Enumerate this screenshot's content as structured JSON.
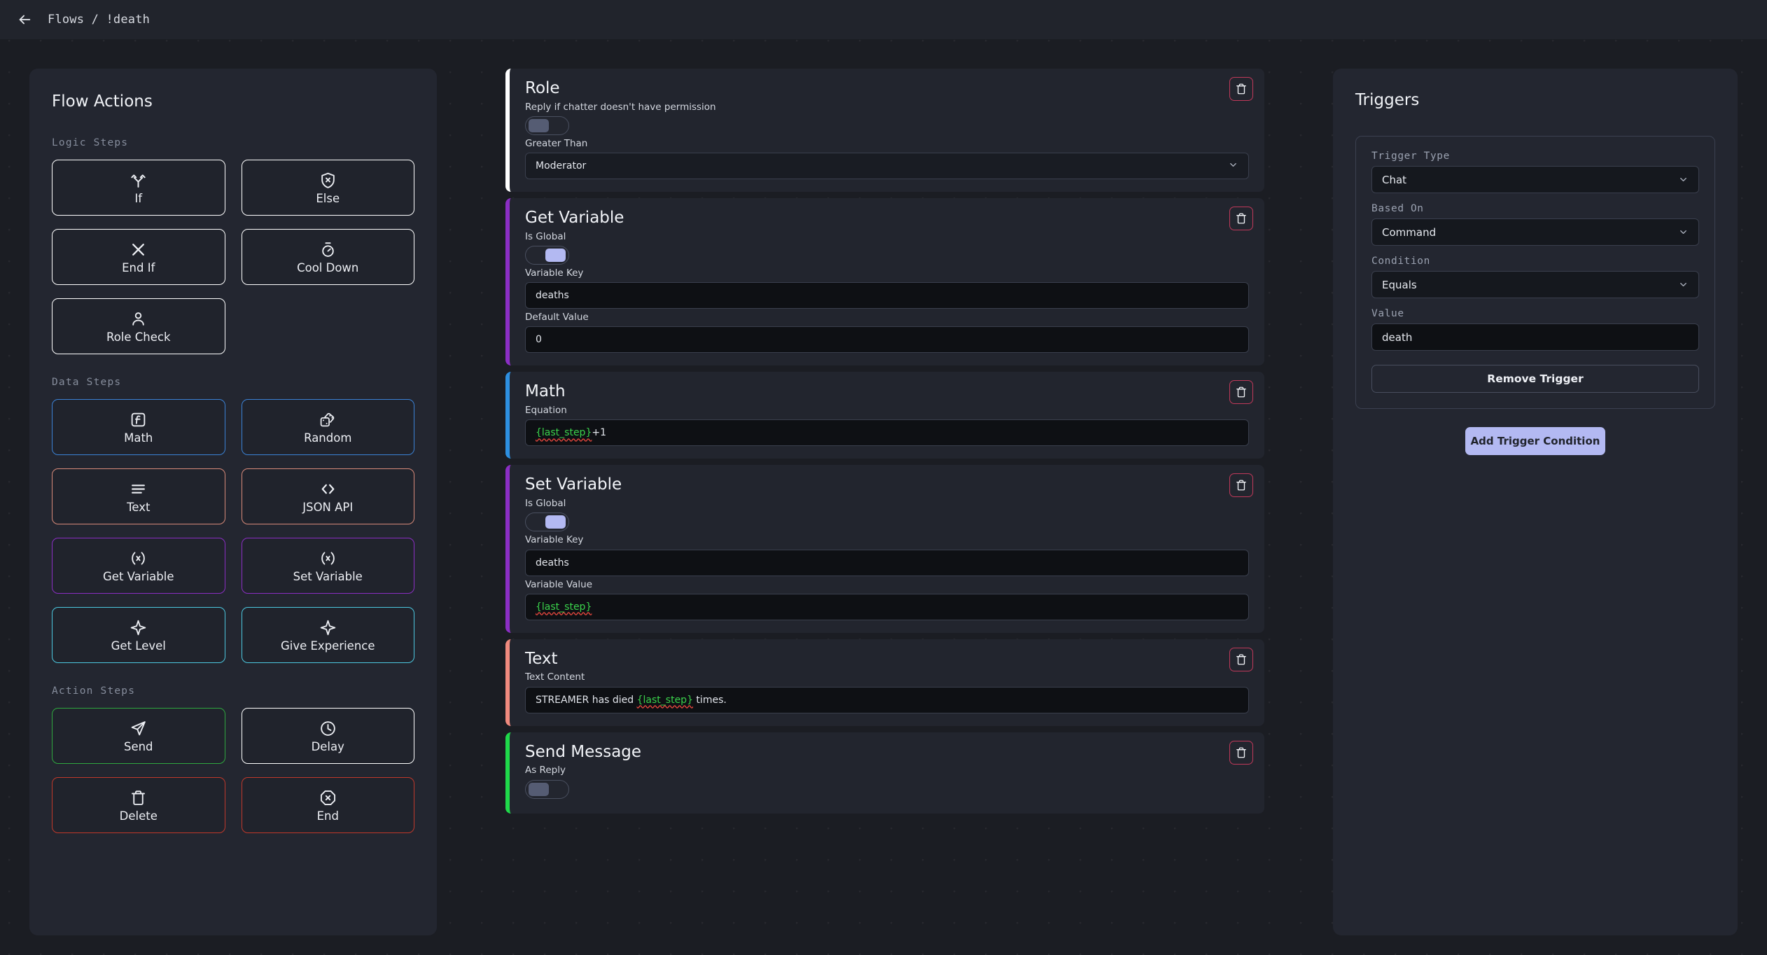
{
  "topbar": {
    "back_icon": "arrow-left-icon",
    "breadcrumb": "Flows / !death"
  },
  "sidebar": {
    "title": "Flow Actions",
    "groups": [
      {
        "label": "Logic Steps",
        "items": [
          {
            "label": "If",
            "icon": "branch-arrows-icon",
            "color": "#ffffff"
          },
          {
            "label": "Else",
            "icon": "shield-x-icon",
            "color": "#ffffff"
          },
          {
            "label": "End If",
            "icon": "x-icon",
            "color": "#ffffff"
          },
          {
            "label": "Cool Down",
            "icon": "stopwatch-icon",
            "color": "#ffffff"
          },
          {
            "label": "Role Check",
            "icon": "user-icon",
            "color": "#ffffff"
          }
        ]
      },
      {
        "label": "Data Steps",
        "items": [
          {
            "label": "Get Level",
            "icon": "sparkle-icon",
            "color": "#4cc8e0"
          },
          {
            "label": "Give Experience",
            "icon": "sparkle-icon",
            "color": "#4cc8e0"
          }
        ],
        "items_full": [
          {
            "label": "Math",
            "icon": "function-box-icon",
            "color": "#3b82d6"
          },
          {
            "label": "Random",
            "icon": "dice-icon",
            "color": "#3b82d6"
          },
          {
            "label": "Text",
            "icon": "lines-icon",
            "color": "#d98b7a"
          },
          {
            "label": "JSON API",
            "icon": "code-brackets-icon",
            "color": "#d98b7a"
          },
          {
            "label": "Get Variable",
            "icon": "variable-x-icon",
            "color": "#8b2ec4"
          },
          {
            "label": "Set Variable",
            "icon": "variable-x-icon",
            "color": "#8b2ec4"
          },
          {
            "label": "Get Level",
            "icon": "sparkle-icon",
            "color": "#4cc8e0"
          },
          {
            "label": "Give Experience",
            "icon": "sparkle-icon",
            "color": "#4cc8e0"
          }
        ]
      },
      {
        "label": "Action Steps",
        "items_full": [
          {
            "label": "Send",
            "icon": "paper-plane-icon",
            "color": "#2fa83f"
          },
          {
            "label": "Delay",
            "icon": "clock-icon",
            "color": "#ffffff"
          },
          {
            "label": "Delete",
            "icon": "trash-icon",
            "color": "#c0392b"
          },
          {
            "label": "End",
            "icon": "octagon-x-icon",
            "color": "#c0392b"
          }
        ]
      }
    ],
    "logic_items": [
      {
        "label": "If",
        "icon": "branch-arrows-icon",
        "color": "#ffffff"
      },
      {
        "label": "Else",
        "icon": "shield-x-icon",
        "color": "#ffffff"
      },
      {
        "label": "End If",
        "icon": "x-icon",
        "color": "#ffffff"
      },
      {
        "label": "Cool Down",
        "icon": "stopwatch-icon",
        "color": "#ffffff"
      },
      {
        "label": "Role Check",
        "icon": "user-icon",
        "color": "#ffffff"
      }
    ],
    "data_items": [
      {
        "label": "Math",
        "icon": "function-box-icon",
        "color": "#3b82d6"
      },
      {
        "label": "Random",
        "icon": "dice-icon",
        "color": "#3b82d6"
      },
      {
        "label": "Text",
        "icon": "lines-icon",
        "color": "#d98b7a"
      },
      {
        "label": "JSON API",
        "icon": "code-brackets-icon",
        "color": "#d98b7a"
      },
      {
        "label": "Get Variable",
        "icon": "variable-x-icon",
        "color": "#8b2ec4"
      },
      {
        "label": "Set Variable",
        "icon": "variable-x-icon",
        "color": "#8b2ec4"
      },
      {
        "label": "Get Level",
        "icon": "sparkle-icon",
        "color": "#4cc8e0"
      },
      {
        "label": "Give Experience",
        "icon": "sparkle-icon",
        "color": "#4cc8e0"
      }
    ],
    "action_items": [
      {
        "label": "Send",
        "icon": "paper-plane-icon",
        "color": "#2fa83f"
      },
      {
        "label": "Delay",
        "icon": "clock-icon",
        "color": "#ffffff"
      },
      {
        "label": "Delete",
        "icon": "trash-icon",
        "color": "#c0392b"
      },
      {
        "label": "End",
        "icon": "octagon-x-icon",
        "color": "#c0392b"
      }
    ],
    "group_labels": {
      "logic": "Logic Steps",
      "data": "Data Steps",
      "action": "Action Steps"
    }
  },
  "flow": {
    "steps": [
      {
        "title": "Role",
        "accent": "#ffffff",
        "fields": [
          {
            "kind": "toggle",
            "label": "Reply if chatter doesn't have permission",
            "state": "off"
          },
          {
            "kind": "select",
            "label": "Greater Than",
            "value": "Moderator"
          }
        ]
      },
      {
        "title": "Get Variable",
        "accent": "#8b2ec4",
        "fields": [
          {
            "kind": "toggle",
            "label": "Is Global",
            "state": "on"
          },
          {
            "kind": "input",
            "label": "Variable Key",
            "value": "deaths"
          },
          {
            "kind": "input",
            "label": "Default Value",
            "value": "0"
          }
        ]
      },
      {
        "title": "Math",
        "accent": "#2d8fe0",
        "fields": [
          {
            "kind": "code",
            "label": "Equation",
            "token": "{last_step}",
            "suffix": "+1"
          }
        ]
      },
      {
        "title": "Set Variable",
        "accent": "#8b2ec4",
        "fields": [
          {
            "kind": "toggle",
            "label": "Is Global",
            "state": "on"
          },
          {
            "kind": "input",
            "label": "Variable Key",
            "value": "deaths"
          },
          {
            "kind": "code",
            "label": "Variable Value",
            "token": "{last_step}",
            "suffix": ""
          }
        ]
      },
      {
        "title": "Text",
        "accent": "#f08a7e",
        "fields": [
          {
            "kind": "code",
            "label": "Text Content",
            "prefix": "STREAMER has died ",
            "token": "{last_step}",
            "suffix": " times."
          }
        ]
      },
      {
        "title": "Send Message",
        "accent": "#1fd94a",
        "fields": [
          {
            "kind": "toggle",
            "label": "As Reply",
            "state": "off"
          }
        ]
      }
    ],
    "delete_icon": "trash-icon"
  },
  "triggers": {
    "title": "Triggers",
    "trigger_type_label": "Trigger Type",
    "trigger_type_value": "Chat",
    "based_on_label": "Based On",
    "based_on_value": "Command",
    "condition_label": "Condition",
    "condition_value": "Equals",
    "value_label": "Value",
    "value_value": "death",
    "remove_trigger_label": "Remove Trigger",
    "add_trigger_label": "Add Trigger Condition",
    "chevron_icon": "chevron-down-icon"
  },
  "colors": {
    "page_bg": "#1b1d23",
    "panel_bg": "#232630",
    "topbar_bg": "#21242c",
    "accent_purple": "#b3b9f2",
    "danger": "#c0395a",
    "code_green": "#3ad14b"
  }
}
